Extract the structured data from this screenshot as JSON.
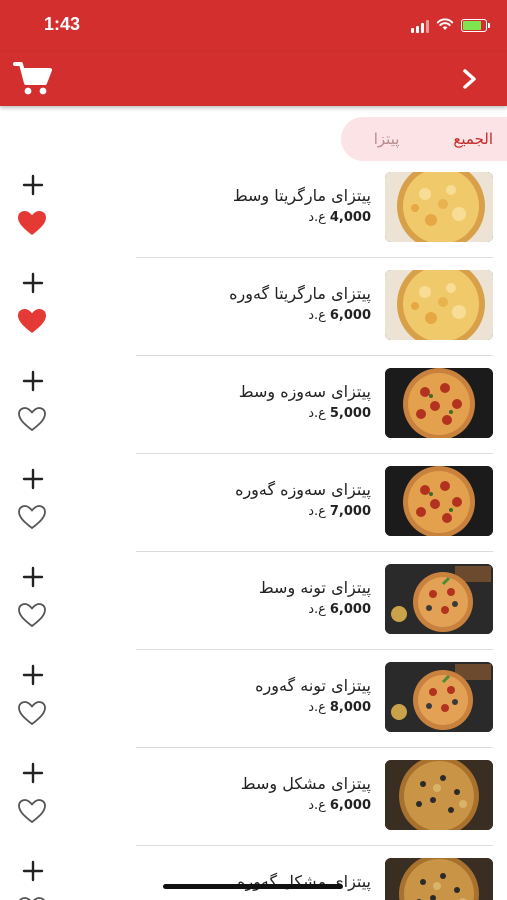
{
  "status_bar": {
    "time": "1:43"
  },
  "header": {
    "cart_icon": "cart-icon",
    "next_icon": "chevron-right-icon"
  },
  "tabs": [
    {
      "label": "الجميع",
      "selected": true
    },
    {
      "label": "پیتزا",
      "selected": false
    }
  ],
  "currency": "ع.د",
  "colors": {
    "primary": "#d32f2f",
    "heart": "#e53935",
    "tab_bg": "#fbe3e6"
  },
  "items": [
    {
      "name": "پیتزای مارگریتا وسط",
      "price": "4,000",
      "favorite": true,
      "image": "margherita"
    },
    {
      "name": "پیتزای مارگریتا گەورە",
      "price": "6,000",
      "favorite": true,
      "image": "margherita"
    },
    {
      "name": "پیتزای سەوزە وسط",
      "price": "5,000",
      "favorite": false,
      "image": "pepperoni"
    },
    {
      "name": "پیتزای سەوزە گەورە",
      "price": "7,000",
      "favorite": false,
      "image": "pepperoni"
    },
    {
      "name": "پیتزای تونە وسط",
      "price": "6,000",
      "favorite": false,
      "image": "tuna"
    },
    {
      "name": "پیتزای تونە گەورە",
      "price": "8,000",
      "favorite": false,
      "image": "tuna"
    },
    {
      "name": "پیتزای مشکل وسط",
      "price": "6,000",
      "favorite": false,
      "image": "mixed"
    },
    {
      "name": "پیتزای مشکل گەورە",
      "price": "",
      "favorite": false,
      "image": "mixed"
    }
  ]
}
